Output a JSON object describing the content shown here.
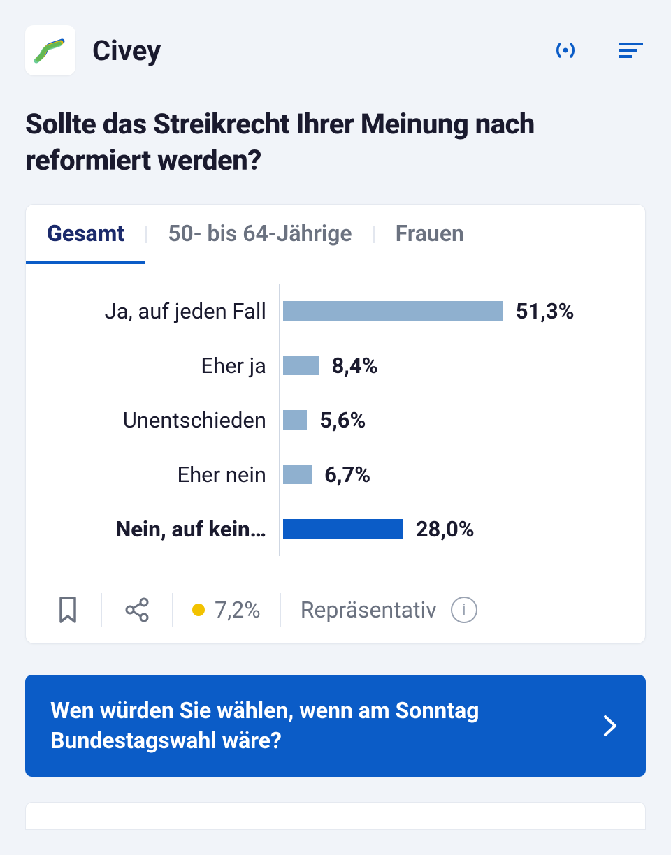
{
  "header": {
    "brand": "Civey"
  },
  "question": "Sollte das Streikrecht Ihrer Meinung nach reformiert werden?",
  "tabs": [
    {
      "label": "Gesamt",
      "active": true
    },
    {
      "label": "50- bis 64-Jährige",
      "active": false
    },
    {
      "label": "Frauen",
      "active": false
    }
  ],
  "chart_data": {
    "type": "bar",
    "title": "Sollte das Streikrecht Ihrer Meinung nach reformiert werden?",
    "xlabel": "",
    "ylabel": "",
    "unit": "%",
    "categories": [
      "Ja, auf jeden Fall",
      "Eher ja",
      "Unentschieden",
      "Eher nein",
      "Nein, auf keinen Fall"
    ],
    "values": [
      51.3,
      8.4,
      5.6,
      6.7,
      28.0
    ],
    "display_labels": [
      "Ja, auf jeden Fall",
      "Eher ja",
      "Unentschieden",
      "Eher nein",
      "Nein, auf kein…"
    ],
    "display_values": [
      "51,3%",
      "8,4%",
      "5,6%",
      "6,7%",
      "28,0%"
    ],
    "selected_index": 4,
    "xlim": [
      0,
      55
    ]
  },
  "meta": {
    "error_margin": "7,2%",
    "representative_label": "Repräsentativ"
  },
  "next_question": "Wen würden Sie wählen, wenn am Sonntag Bundestagswahl wäre?",
  "colors": {
    "brand": "#0b5cc7",
    "bar_light": "#8fb0cf",
    "bar_dark": "#0b5cc7",
    "warn": "#f2c200"
  }
}
